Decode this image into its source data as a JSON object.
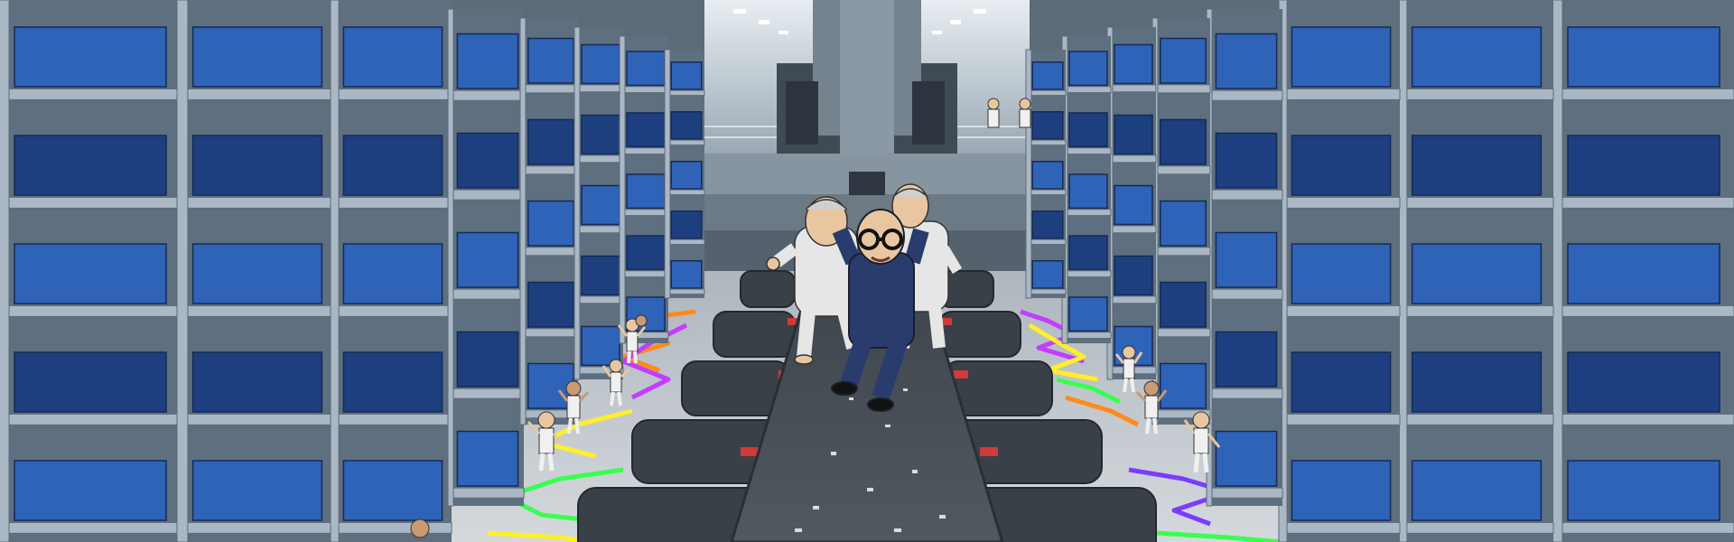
{
  "scene": {
    "caption": "",
    "colors": {
      "shelf_frame": "#aab7c4",
      "bin_blue": "#2f63b8",
      "bin_dark": "#1e3f7f",
      "back_wall": "#5e6f80",
      "floor": "#c9ced3",
      "belt": "#4a5058",
      "suit": "#2a3c6e",
      "worker_suit": "#e6e6e6",
      "neon": [
        "#ff8a1a",
        "#c33cff",
        "#38ff4f",
        "#ffef2a",
        "#7a3cff"
      ]
    },
    "elements": [
      "left-shelving",
      "right-shelving",
      "back-machine",
      "conveyor-belt",
      "dancing-man-with-glasses",
      "worker-left",
      "worker-right",
      "small-workers",
      "neon-floor-lines"
    ]
  }
}
